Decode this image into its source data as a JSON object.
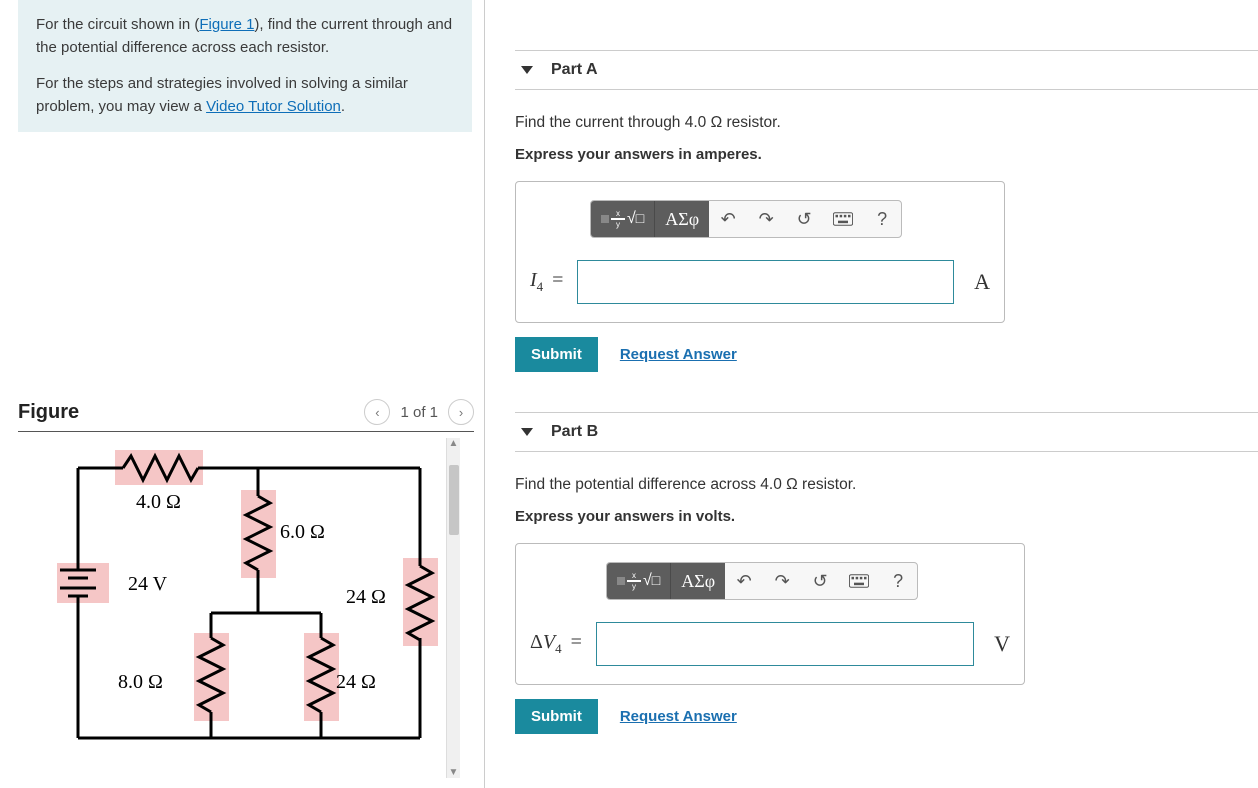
{
  "intro": {
    "text_before_link": "For the circuit shown in (",
    "figure_link": "Figure 1",
    "text_after_link": "), find the current through and the potential difference across each resistor.",
    "para2_before": "For the steps and strategies involved in solving a similar problem, you may view a ",
    "video_link": "Video Tutor Solution",
    "text_after_video": "."
  },
  "figure": {
    "title": "Figure",
    "pager": "1 of 1",
    "labels": {
      "r4": "4.0 Ω",
      "r6": "6.0 Ω",
      "v24": "24 V",
      "r24a": "24 Ω",
      "r8": "8.0 Ω",
      "r24b": "24 Ω"
    }
  },
  "partA": {
    "title": "Part A",
    "prompt_before": "Find the current through 4.0 ",
    "prompt_after": " resistor.",
    "instructions": "Express your answers in amperes.",
    "var_main": "I",
    "var_sub": "4",
    "unit": "A",
    "submit": "Submit",
    "request": "Request Answer"
  },
  "partB": {
    "title": "Part B",
    "prompt_before": "Find the potential difference across 4.0 ",
    "prompt_after": " resistor.",
    "instructions": "Express your answers in volts.",
    "var_prefix": "Δ",
    "var_main": "V",
    "var_sub": "4",
    "unit": "V",
    "submit": "Submit",
    "request": "Request Answer"
  },
  "toolbar": {
    "greek": "ΑΣφ",
    "help": "?"
  },
  "ohm": "Ω"
}
